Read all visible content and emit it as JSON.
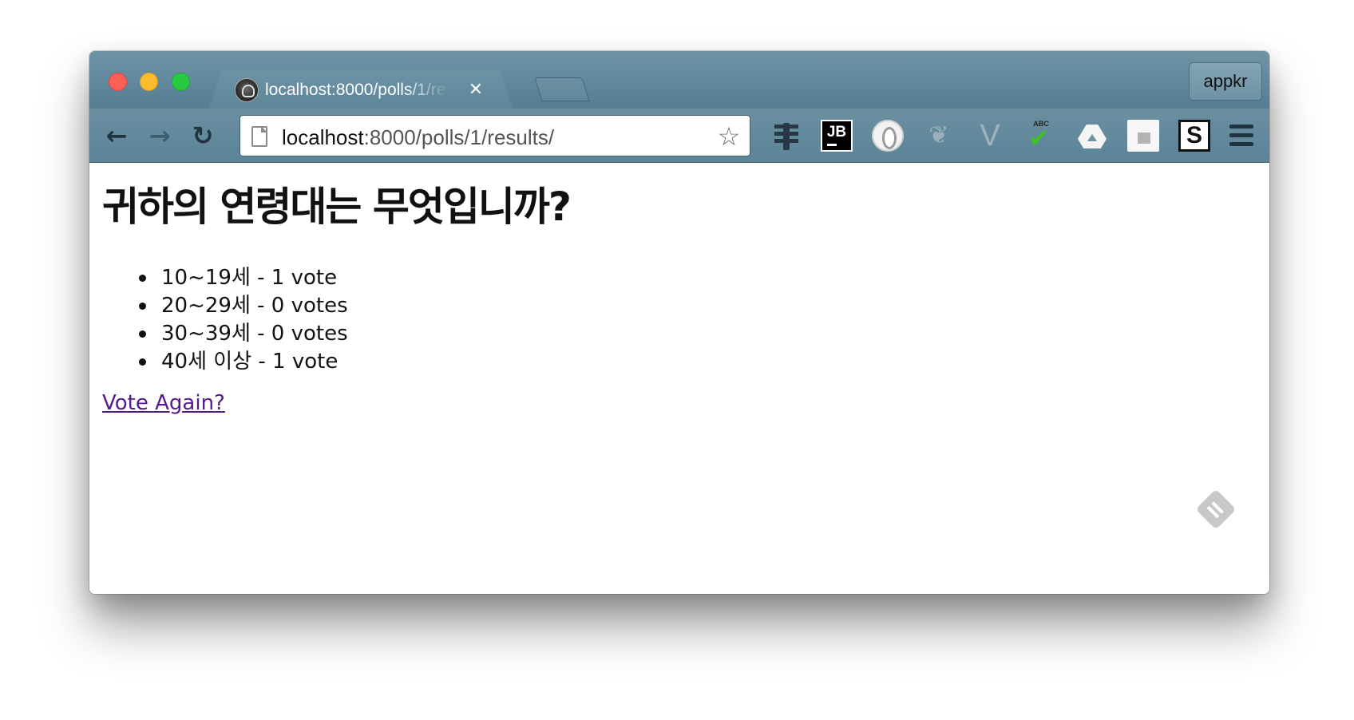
{
  "browser": {
    "tab": {
      "title": "localhost:8000/polls/1/results/",
      "close_glyph": "✕"
    },
    "profile_label": "appkr",
    "nav": {
      "back_glyph": "←",
      "forward_glyph": "→",
      "reload_glyph": "↻"
    },
    "address": {
      "host": "localhost",
      "path": ":8000/polls/1/results/"
    },
    "extensions": [
      {
        "icon": "traffic-light-icon"
      },
      {
        "icon": "jetbrains-icon",
        "label": "JB"
      },
      {
        "icon": "opera-icon"
      },
      {
        "icon": "feather-icon"
      },
      {
        "icon": "vue-icon",
        "label": "V"
      },
      {
        "icon": "spellcheck-icon",
        "label": "ABC"
      },
      {
        "icon": "google-drive-icon"
      },
      {
        "icon": "blank-extension-icon"
      },
      {
        "icon": "s-icon",
        "label": "S"
      }
    ]
  },
  "page": {
    "question": "귀하의 연령대는 무엇입니까?",
    "choices": [
      {
        "text": "10~19세 - 1 vote"
      },
      {
        "text": "20~29세 - 0 votes"
      },
      {
        "text": "30~39세 - 0 votes"
      },
      {
        "text": "40세 이상 - 1 vote"
      }
    ],
    "vote_again": "Vote Again?"
  },
  "colors": {
    "chrome_frame": "#5d8699",
    "link_visited": "#551a8b",
    "close": "#fc5f57",
    "minimize": "#fdbc2e",
    "zoom": "#29c940"
  }
}
